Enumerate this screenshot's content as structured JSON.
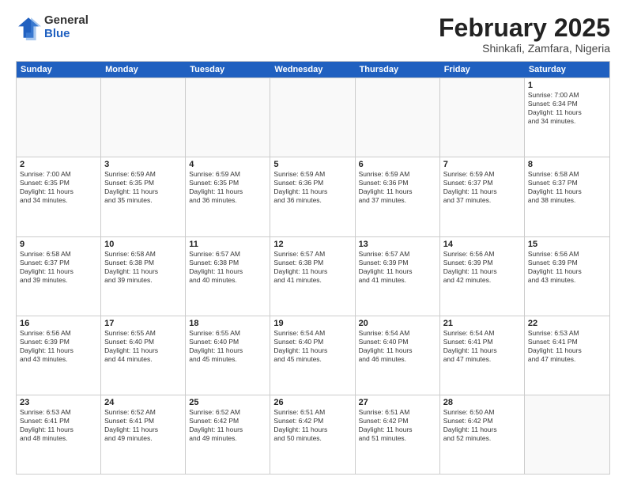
{
  "logo": {
    "general": "General",
    "blue": "Blue"
  },
  "title": "February 2025",
  "location": "Shinkafi, Zamfara, Nigeria",
  "days_of_week": [
    "Sunday",
    "Monday",
    "Tuesday",
    "Wednesday",
    "Thursday",
    "Friday",
    "Saturday"
  ],
  "weeks": [
    [
      {
        "day": "",
        "info": ""
      },
      {
        "day": "",
        "info": ""
      },
      {
        "day": "",
        "info": ""
      },
      {
        "day": "",
        "info": ""
      },
      {
        "day": "",
        "info": ""
      },
      {
        "day": "",
        "info": ""
      },
      {
        "day": "1",
        "info": "Sunrise: 7:00 AM\nSunset: 6:34 PM\nDaylight: 11 hours\nand 34 minutes."
      }
    ],
    [
      {
        "day": "2",
        "info": "Sunrise: 7:00 AM\nSunset: 6:35 PM\nDaylight: 11 hours\nand 34 minutes."
      },
      {
        "day": "3",
        "info": "Sunrise: 6:59 AM\nSunset: 6:35 PM\nDaylight: 11 hours\nand 35 minutes."
      },
      {
        "day": "4",
        "info": "Sunrise: 6:59 AM\nSunset: 6:35 PM\nDaylight: 11 hours\nand 36 minutes."
      },
      {
        "day": "5",
        "info": "Sunrise: 6:59 AM\nSunset: 6:36 PM\nDaylight: 11 hours\nand 36 minutes."
      },
      {
        "day": "6",
        "info": "Sunrise: 6:59 AM\nSunset: 6:36 PM\nDaylight: 11 hours\nand 37 minutes."
      },
      {
        "day": "7",
        "info": "Sunrise: 6:59 AM\nSunset: 6:37 PM\nDaylight: 11 hours\nand 37 minutes."
      },
      {
        "day": "8",
        "info": "Sunrise: 6:58 AM\nSunset: 6:37 PM\nDaylight: 11 hours\nand 38 minutes."
      }
    ],
    [
      {
        "day": "9",
        "info": "Sunrise: 6:58 AM\nSunset: 6:37 PM\nDaylight: 11 hours\nand 39 minutes."
      },
      {
        "day": "10",
        "info": "Sunrise: 6:58 AM\nSunset: 6:38 PM\nDaylight: 11 hours\nand 39 minutes."
      },
      {
        "day": "11",
        "info": "Sunrise: 6:57 AM\nSunset: 6:38 PM\nDaylight: 11 hours\nand 40 minutes."
      },
      {
        "day": "12",
        "info": "Sunrise: 6:57 AM\nSunset: 6:38 PM\nDaylight: 11 hours\nand 41 minutes."
      },
      {
        "day": "13",
        "info": "Sunrise: 6:57 AM\nSunset: 6:39 PM\nDaylight: 11 hours\nand 41 minutes."
      },
      {
        "day": "14",
        "info": "Sunrise: 6:56 AM\nSunset: 6:39 PM\nDaylight: 11 hours\nand 42 minutes."
      },
      {
        "day": "15",
        "info": "Sunrise: 6:56 AM\nSunset: 6:39 PM\nDaylight: 11 hours\nand 43 minutes."
      }
    ],
    [
      {
        "day": "16",
        "info": "Sunrise: 6:56 AM\nSunset: 6:39 PM\nDaylight: 11 hours\nand 43 minutes."
      },
      {
        "day": "17",
        "info": "Sunrise: 6:55 AM\nSunset: 6:40 PM\nDaylight: 11 hours\nand 44 minutes."
      },
      {
        "day": "18",
        "info": "Sunrise: 6:55 AM\nSunset: 6:40 PM\nDaylight: 11 hours\nand 45 minutes."
      },
      {
        "day": "19",
        "info": "Sunrise: 6:54 AM\nSunset: 6:40 PM\nDaylight: 11 hours\nand 45 minutes."
      },
      {
        "day": "20",
        "info": "Sunrise: 6:54 AM\nSunset: 6:40 PM\nDaylight: 11 hours\nand 46 minutes."
      },
      {
        "day": "21",
        "info": "Sunrise: 6:54 AM\nSunset: 6:41 PM\nDaylight: 11 hours\nand 47 minutes."
      },
      {
        "day": "22",
        "info": "Sunrise: 6:53 AM\nSunset: 6:41 PM\nDaylight: 11 hours\nand 47 minutes."
      }
    ],
    [
      {
        "day": "23",
        "info": "Sunrise: 6:53 AM\nSunset: 6:41 PM\nDaylight: 11 hours\nand 48 minutes."
      },
      {
        "day": "24",
        "info": "Sunrise: 6:52 AM\nSunset: 6:41 PM\nDaylight: 11 hours\nand 49 minutes."
      },
      {
        "day": "25",
        "info": "Sunrise: 6:52 AM\nSunset: 6:42 PM\nDaylight: 11 hours\nand 49 minutes."
      },
      {
        "day": "26",
        "info": "Sunrise: 6:51 AM\nSunset: 6:42 PM\nDaylight: 11 hours\nand 50 minutes."
      },
      {
        "day": "27",
        "info": "Sunrise: 6:51 AM\nSunset: 6:42 PM\nDaylight: 11 hours\nand 51 minutes."
      },
      {
        "day": "28",
        "info": "Sunrise: 6:50 AM\nSunset: 6:42 PM\nDaylight: 11 hours\nand 52 minutes."
      },
      {
        "day": "",
        "info": ""
      }
    ]
  ]
}
